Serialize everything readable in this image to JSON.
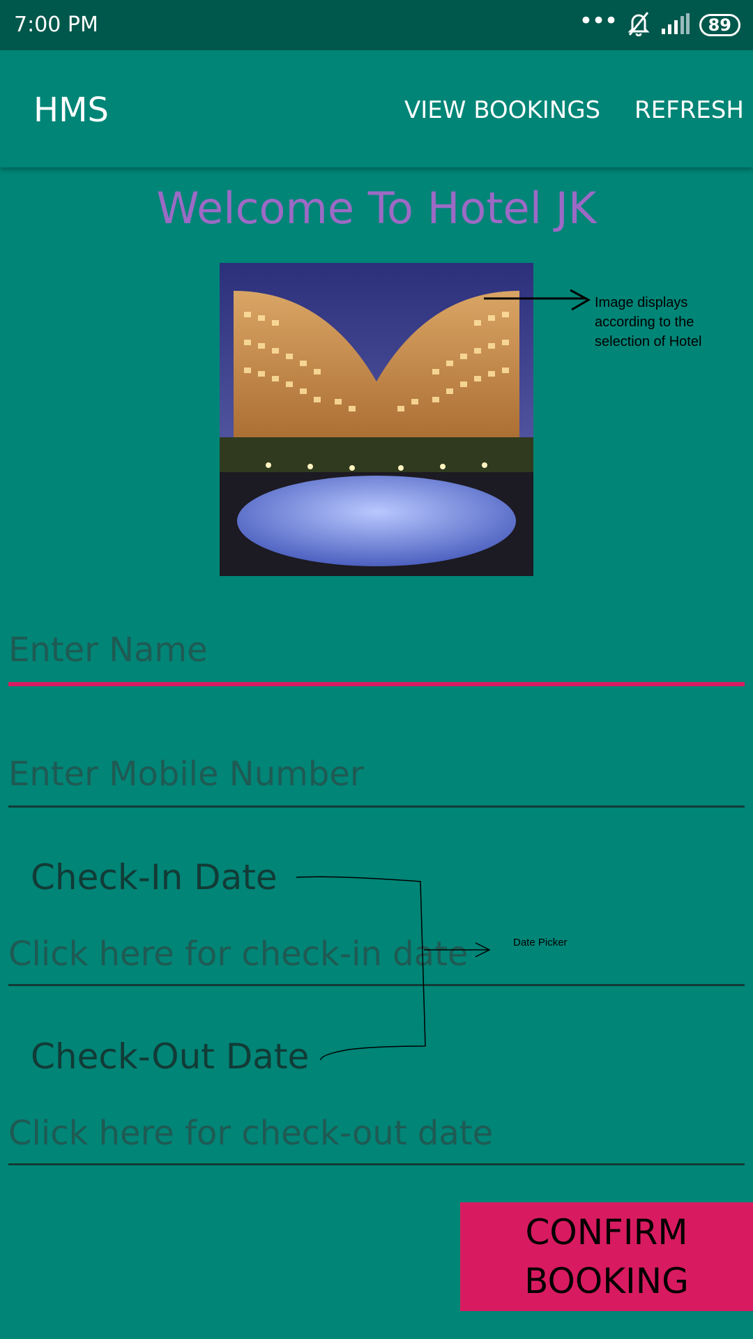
{
  "status_bar": {
    "time": "7:00 PM",
    "battery": "89",
    "icons": [
      "more-dots-icon",
      "bell-off-icon",
      "signal-icon",
      "battery-icon"
    ]
  },
  "app_bar": {
    "title": "HMS",
    "actions": {
      "view_bookings": "VIEW BOOKINGS",
      "refresh": "REFRESH"
    }
  },
  "main": {
    "welcome": "Welcome To Hotel JK",
    "image_annotation": "Image displays according to the selection of  Hotel",
    "name_placeholder": "Enter Name",
    "mobile_placeholder": "Enter Mobile Number",
    "checkin_label": "Check-In Date",
    "checkin_placeholder": "Click here for check-in date",
    "checkout_label": "Check-Out Date",
    "checkout_placeholder": "Click here for check-out date",
    "date_picker_annotation": "Date  Picker",
    "confirm_button": "CONFIRM BOOKING"
  },
  "colors": {
    "primary": "#008577",
    "primary_dark": "#00574B",
    "accent": "#D81B60",
    "welcome_text": "#9C6AC5"
  }
}
